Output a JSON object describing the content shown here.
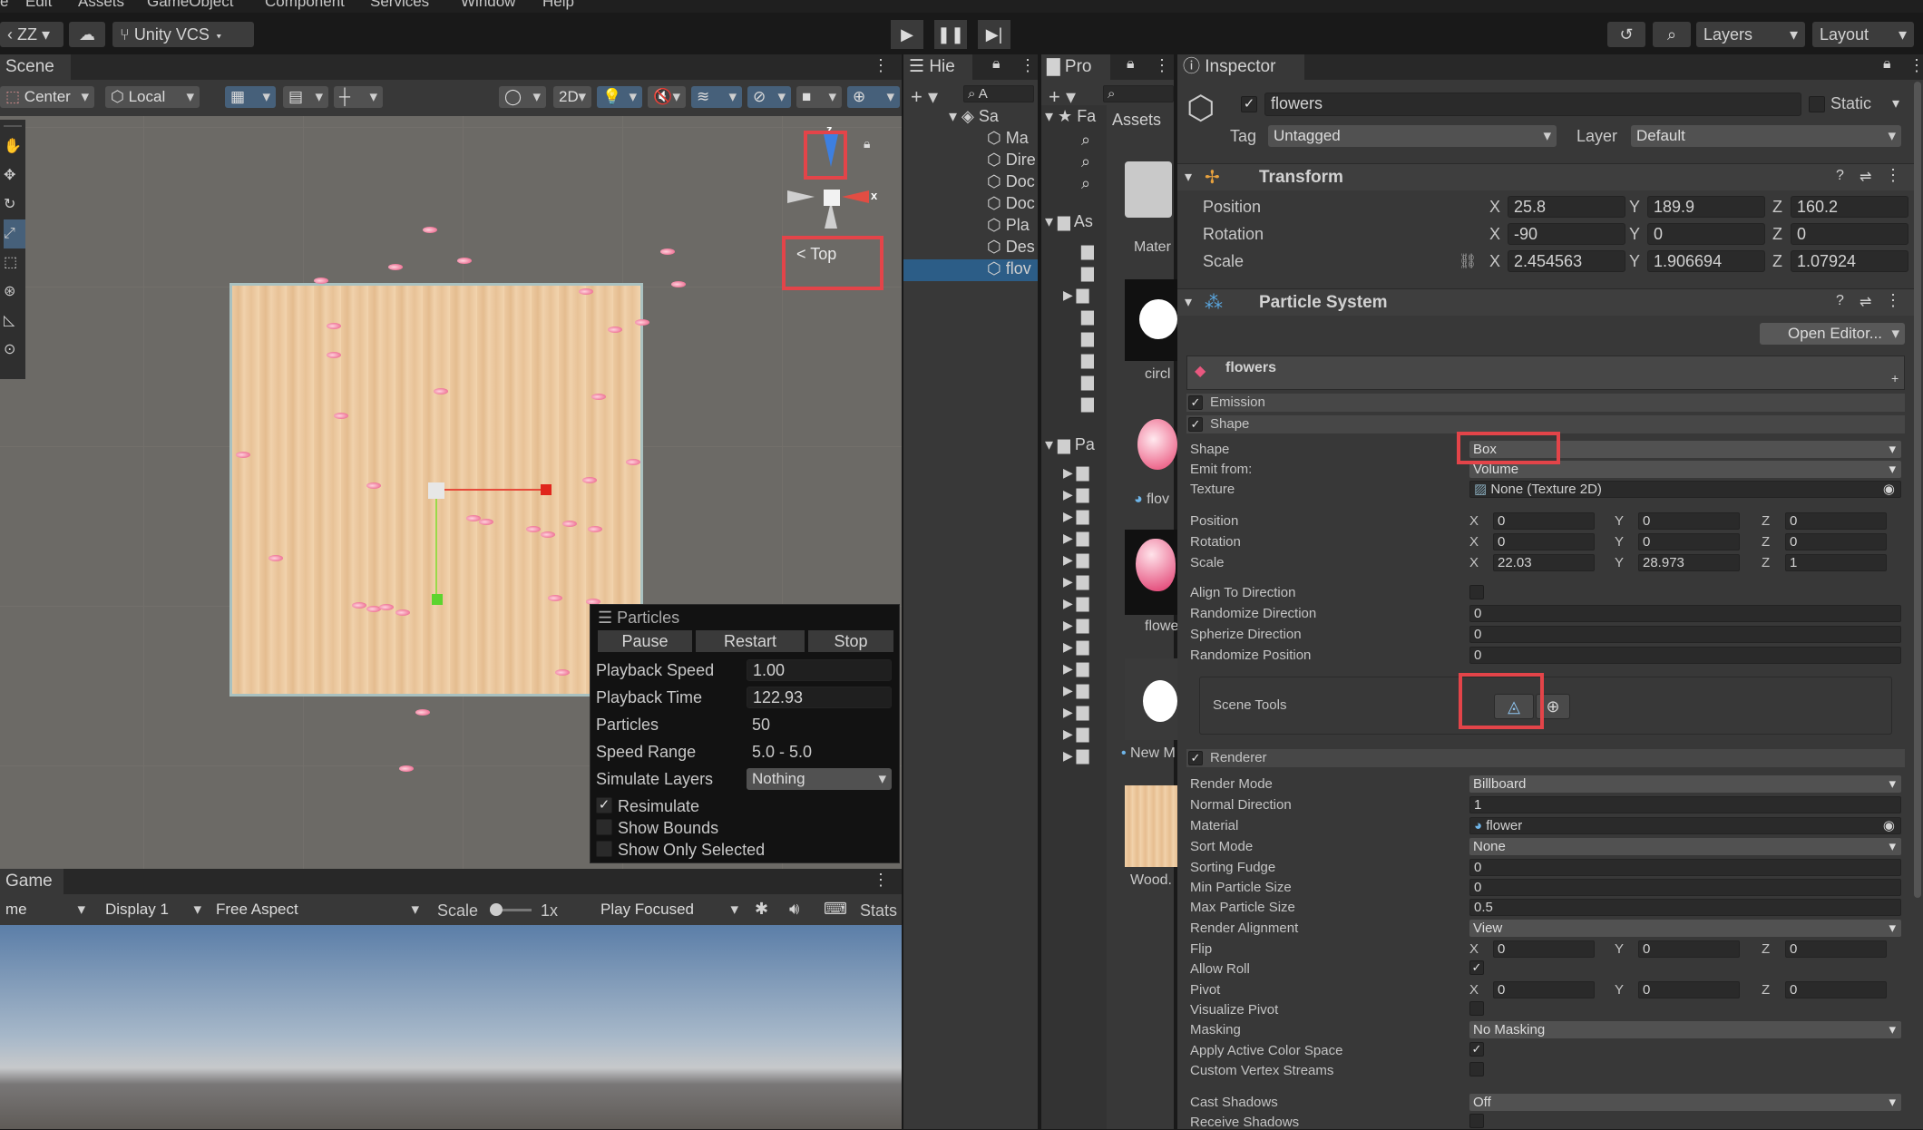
{
  "menu": [
    "Edit",
    "Assets",
    "GameObject",
    "Component",
    "Services",
    "Window",
    "Help"
  ],
  "toolbar": {
    "account": "ZZ",
    "vcs": "Unity VCS",
    "layers": "Layers",
    "layout": "Layout"
  },
  "scene": {
    "tab": "Scene",
    "pivot": "Center",
    "space": "Local",
    "mode2d": "2D",
    "gizmo_label": "Top",
    "gizmo_z": "z",
    "gizmo_x": "x"
  },
  "particles": {
    "title": "Particles",
    "pause": "Pause",
    "restart": "Restart",
    "stop": "Stop",
    "rows": [
      {
        "label": "Playback Speed",
        "value": "1.00"
      },
      {
        "label": "Playback Time",
        "value": "122.93"
      },
      {
        "label": "Particles",
        "value": "50"
      },
      {
        "label": "Speed Range",
        "value": "5.0 - 5.0"
      }
    ],
    "simulate_label": "Simulate Layers",
    "simulate_value": "Nothing",
    "resimulate": "Resimulate",
    "show_bounds": "Show Bounds",
    "show_only_selected": "Show Only Selected"
  },
  "game": {
    "tab": "Game",
    "mode": "me",
    "display": "Display 1",
    "aspect": "Free Aspect",
    "scale_label": "Scale",
    "scale_value": "1x",
    "play_focused": "Play Focused",
    "stats": "Stats"
  },
  "hierarchy": {
    "tab": "Hie",
    "search": "A",
    "scene_root": "Sa",
    "items": [
      "Ma",
      "Dire",
      "Doc",
      "Doc",
      "Pla",
      "Des",
      "flov"
    ]
  },
  "project": {
    "tab": "Pro",
    "favorites": "Fa",
    "assets_root": "As",
    "packages_root": "Pa",
    "breadcrumb": "Assets",
    "assets": [
      {
        "name": "Mater"
      },
      {
        "name": "circl"
      },
      {
        "name": "flov"
      },
      {
        "name": "flowe"
      },
      {
        "name": "New M"
      },
      {
        "name": "Wood."
      }
    ]
  },
  "inspector": {
    "tab": "Inspector",
    "object_name": "flowers",
    "static_label": "Static",
    "tag_label": "Tag",
    "tag_value": "Untagged",
    "layer_label": "Layer",
    "layer_value": "Default",
    "transform": {
      "title": "Transform",
      "position_label": "Position",
      "rotation_label": "Rotation",
      "scale_label": "Scale",
      "position": [
        "25.8",
        "189.9",
        "160.2"
      ],
      "rotation": [
        "-90",
        "0",
        "0"
      ],
      "scale": [
        "2.454563",
        "1.906694",
        "1.07924"
      ]
    },
    "particle_system": {
      "title": "Particle System",
      "open_editor": "Open Editor...",
      "system_name": "flowers",
      "emission": "Emission",
      "shape_module": "Shape",
      "shape_label": "Shape",
      "shape_value": "Box",
      "emit_from_label": "Emit from:",
      "emit_from_value": "Volume",
      "texture_label": "Texture",
      "texture_value": "None (Texture 2D)",
      "position_label": "Position",
      "rotation_label": "Rotation",
      "scale_label": "Scale",
      "position": [
        "0",
        "0",
        "0"
      ],
      "rotation": [
        "0",
        "0",
        "0"
      ],
      "scale": [
        "22.03",
        "28.973",
        "1"
      ],
      "align_label": "Align To Direction",
      "randomize_dir_label": "Randomize Direction",
      "randomize_dir": "0",
      "spherize_label": "Spherize Direction",
      "spherize": "0",
      "randomize_pos_label": "Randomize Position",
      "randomize_pos": "0",
      "scene_tools": "Scene Tools",
      "renderer": "Renderer",
      "render_mode_label": "Render Mode",
      "render_mode": "Billboard",
      "normal_dir_label": "Normal Direction",
      "normal_dir": "1",
      "material_label": "Material",
      "material": "flower",
      "sort_mode_label": "Sort Mode",
      "sort_mode": "None",
      "sorting_fudge_label": "Sorting Fudge",
      "sorting_fudge": "0",
      "min_size_label": "Min Particle Size",
      "min_size": "0",
      "max_size_label": "Max Particle Size",
      "max_size": "0.5",
      "alignment_label": "Render Alignment",
      "alignment": "View",
      "flip_label": "Flip",
      "flip": [
        "0",
        "0",
        "0"
      ],
      "allow_roll_label": "Allow Roll",
      "pivot_label": "Pivot",
      "pivot": [
        "0",
        "0",
        "0"
      ],
      "visualize_pivot_label": "Visualize Pivot",
      "masking_label": "Masking",
      "masking": "No Masking",
      "color_space_label": "Apply Active Color Space",
      "custom_streams_label": "Custom Vertex Streams",
      "cast_shadows_label": "Cast Shadows",
      "cast_shadows": "Off",
      "receive_shadows_label": "Receive Shadows"
    }
  },
  "axes": {
    "x": "X",
    "y": "Y",
    "z": "Z"
  }
}
